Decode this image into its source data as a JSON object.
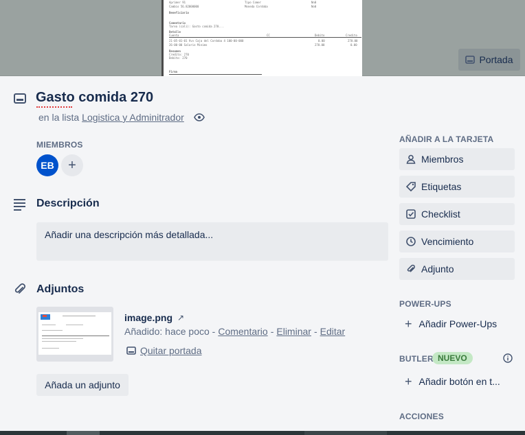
{
  "cover": {
    "button_label": "Portada",
    "doc_fragments": {
      "line1a": "Aprimer  91",
      "line1b": "Tipo  Comer",
      "line1c": "Nn0",
      "line2a": "Cambio  56.82000000",
      "line2b": "Moneda  Cordoba",
      "line2c": "No0",
      "line3": "Beneficiario",
      "line4": "Comentario",
      "line5": "Tarea (cali): Gasto comida 270...",
      "line6": "Detalle",
      "line7": "Cuenta",
      "line7b": "CC",
      "line7c": "Debito",
      "line7d": "Credito",
      "line8": "21-05-01-01 Vvv Caja del Cordoba 4 100-00-000",
      "line8b": "0.00",
      "line8c": "270.00",
      "line9": "26-00-00 Salario Minimo",
      "line9b": "270.00",
      "line9c": "0.00",
      "line10": "Resumen",
      "line11": "Credito:   270",
      "line12": "Debito:    270",
      "line13": "Firma"
    }
  },
  "card": {
    "title": "Gasto comida 270",
    "list_prefix": "en la lista",
    "list_name": "Logistica y Adminitrador"
  },
  "members": {
    "label": "MIEMBROS",
    "avatar_initials": "EB",
    "add_symbol": "+"
  },
  "description": {
    "title": "Descripción",
    "placeholder": "Añadir una descripción más detallada..."
  },
  "attachments": {
    "title": "Adjuntos",
    "file_name": "image.png",
    "open_symbol": "↗",
    "added_text": "Añadido: hace poco -",
    "comment_link": "Comentario",
    "sep1": "-",
    "delete_link": "Eliminar",
    "sep2": "-",
    "edit_link": "Editar",
    "remove_cover": "Quitar portada",
    "add_button": "Añada un adjunto"
  },
  "sidebar": {
    "add_to_card_label": "AÑADIR A LA TARJETA",
    "buttons": [
      {
        "label": "Miembros",
        "icon": "person-icon"
      },
      {
        "label": "Etiquetas",
        "icon": "tag-icon"
      },
      {
        "label": "Checklist",
        "icon": "checkbox-icon"
      },
      {
        "label": "Vencimiento",
        "icon": "clock-icon"
      },
      {
        "label": "Adjunto",
        "icon": "paperclip-icon"
      }
    ],
    "powerups_label": "POWER-UPS",
    "powerups_add": "Añadir Power-Ups",
    "butler_label": "BUTLER",
    "butler_badge": "NUEVO",
    "butler_add": "Añadir botón en t...",
    "actions_label": "ACCIONES"
  },
  "colors": {
    "accent": "#0052cc",
    "badge_bg": "#c4e8c5",
    "badge_text": "#3a7a3c"
  }
}
